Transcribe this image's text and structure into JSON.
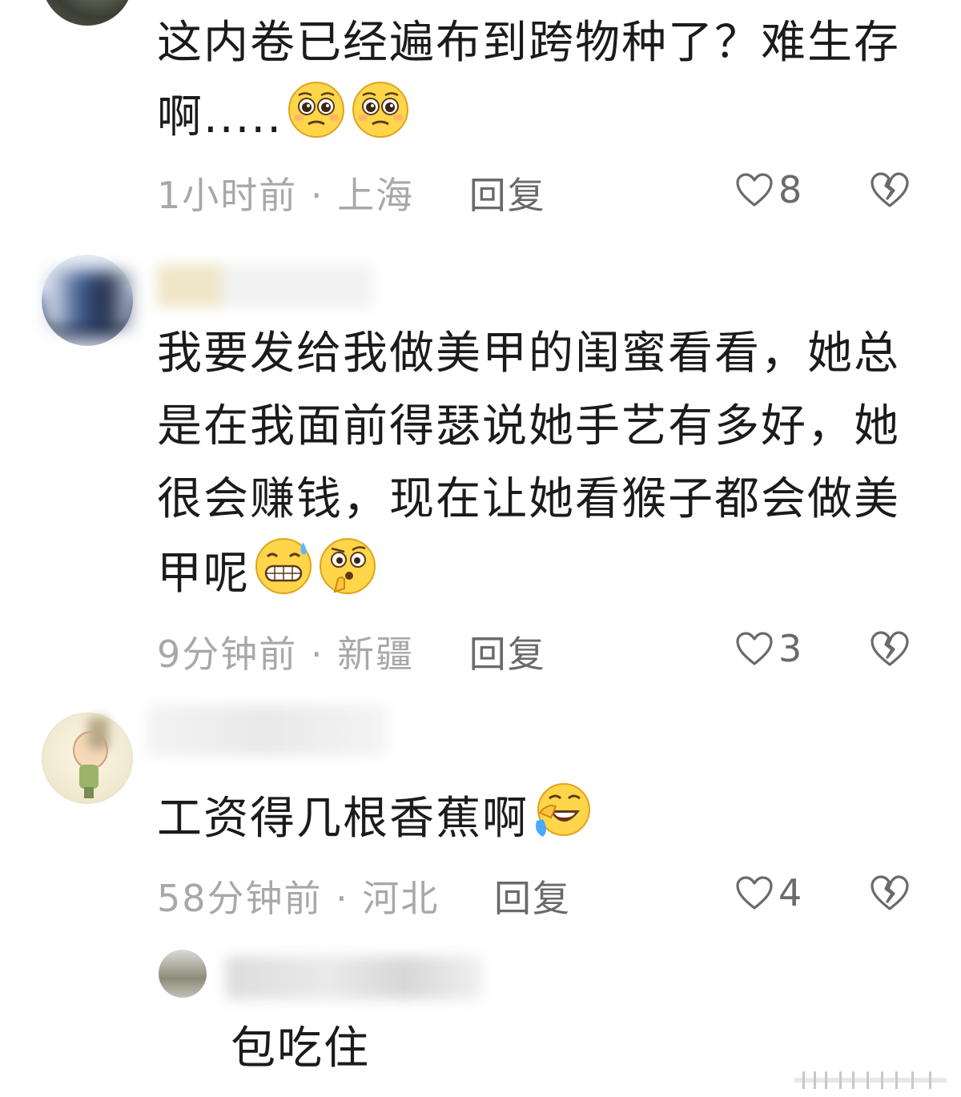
{
  "comments": [
    {
      "text": "这内卷已经遍布到跨物种了？难生存啊.....",
      "emojis": [
        "pleading-face-emoji",
        "pleading-face-emoji"
      ],
      "time": "1小时前",
      "location": "上海",
      "reply": "回复",
      "likes": "8"
    },
    {
      "text": "我要发给我做美甲的闺蜜看看，她总是在我面前得瑟说她手艺有多好，她很会赚钱，现在让她看猴子都会做美甲呢",
      "emojis": [
        "grinning-sweat-emoji",
        "thinking-face-emoji"
      ],
      "time": "9分钟前",
      "location": "新疆",
      "reply": "回复",
      "likes": "3"
    },
    {
      "text": "工资得几根香蕉啊",
      "emojis": [
        "rolling-laughing-emoji"
      ],
      "time": "58分钟前",
      "location": "河北",
      "reply": "回复",
      "likes": "4"
    }
  ],
  "reply_comment": {
    "text": "包吃住"
  },
  "separator": "·",
  "icons": {
    "like": "heart-outline-icon",
    "dislike": "broken-heart-icon"
  },
  "colors": {
    "text": "#1b1b1b",
    "meta": "#a8a8a8",
    "reply": "#6a6a6a"
  }
}
